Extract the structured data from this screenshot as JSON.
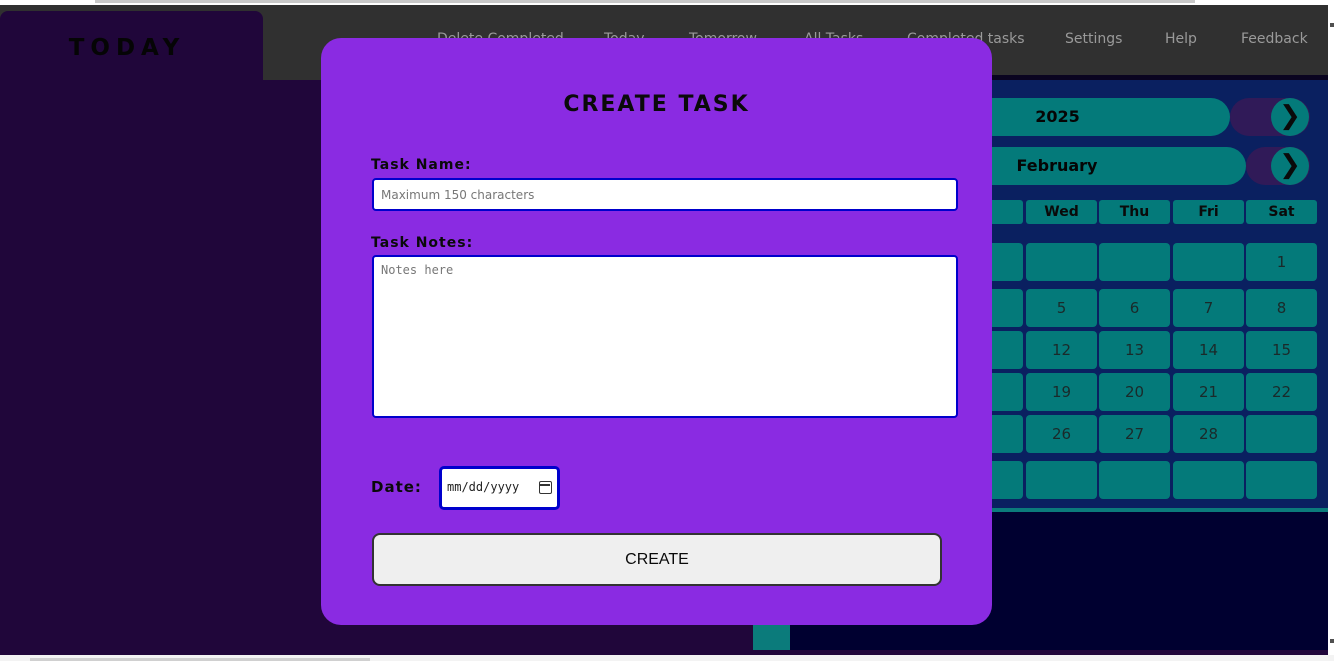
{
  "header": {
    "logo_text": "TODAY",
    "nav": [
      "Delete Completed",
      "Today",
      "Tomorrow",
      "All Tasks",
      "Completed tasks",
      "Settings",
      "Help",
      "Feedback"
    ]
  },
  "calendar": {
    "year": "2025",
    "month": "February",
    "next_icon": "chevron-right-icon",
    "day_headers": [
      "e",
      "Wed",
      "Thu",
      "Fri",
      "Sat"
    ],
    "rows": [
      [
        "",
        "",
        "",
        "",
        "1"
      ],
      [
        "",
        "5",
        "6",
        "7",
        "8"
      ],
      [
        "",
        "12",
        "13",
        "14",
        "15"
      ],
      [
        "8",
        "19",
        "20",
        "21",
        "22"
      ],
      [
        "",
        "26",
        "27",
        "28",
        ""
      ],
      [
        "",
        "",
        "",
        "",
        ""
      ]
    ]
  },
  "modal": {
    "title": "CREATE TASK",
    "task_name_label": "Task Name:",
    "task_name_placeholder": "Maximum 150 characters",
    "task_notes_label": "Task Notes:",
    "task_notes_placeholder": "Notes here",
    "date_label": "Date:",
    "date_value": "mm/dd/yyyy",
    "date_icon": "calendar-icon",
    "create_label": "CREATE"
  },
  "colors": {
    "modal_bg": "#8a2be2",
    "app_bg": "#20063a",
    "teal": "#047a7a",
    "input_border": "#0000cc"
  }
}
